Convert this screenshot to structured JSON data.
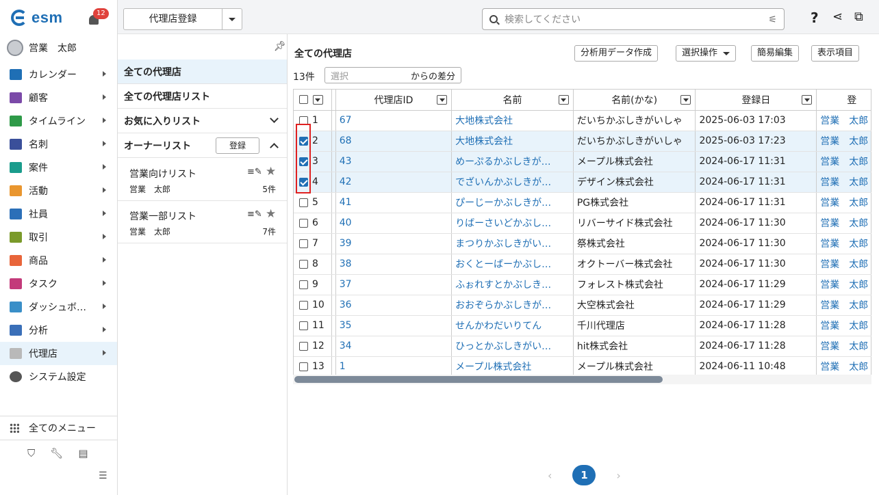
{
  "app": {
    "brand": "esm",
    "notification_count": "12"
  },
  "user": {
    "name": "営業　太郎"
  },
  "nav": {
    "items": [
      {
        "label": "カレンダー",
        "icon": "calendar-icon",
        "color": "#1f6fb5"
      },
      {
        "label": "顧客",
        "icon": "building-icon",
        "color": "#7b4aa8"
      },
      {
        "label": "タイムライン",
        "icon": "chat-icon",
        "color": "#2e9a48"
      },
      {
        "label": "名刺",
        "icon": "card-icon",
        "color": "#3a4f9a"
      },
      {
        "label": "案件",
        "icon": "folder-icon",
        "color": "#1a9c8c"
      },
      {
        "label": "活動",
        "icon": "clipboard-icon",
        "color": "#e9962f"
      },
      {
        "label": "社員",
        "icon": "person-icon",
        "color": "#2b6fb8"
      },
      {
        "label": "取引",
        "icon": "book-icon",
        "color": "#7a9a2a"
      },
      {
        "label": "商品",
        "icon": "box-icon",
        "color": "#e8653a"
      },
      {
        "label": "タスク",
        "icon": "task-icon",
        "color": "#c33a7a"
      },
      {
        "label": "ダッシュボ…",
        "icon": "dashboard-icon",
        "color": "#3a8fc8"
      },
      {
        "label": "分析",
        "icon": "chart-icon",
        "color": "#3a6fb8"
      },
      {
        "label": "代理店",
        "icon": "agency-icon",
        "color": "#b9b9b9"
      },
      {
        "label": "システム設定",
        "icon": "gear-icon",
        "color": "#555555"
      }
    ],
    "all_menu": "全てのメニュー"
  },
  "topbar": {
    "object_button": "代理店登録",
    "search_placeholder": "検索してください"
  },
  "lists": {
    "all": "全ての代理店",
    "all_list": "全ての代理店リスト",
    "favorites": "お気に入りリスト",
    "owner": "オーナーリスト",
    "register": "登録",
    "owner_items": [
      {
        "title": "営業向けリスト",
        "user": "営業　太郎",
        "count": "5件"
      },
      {
        "title": "営業一部リスト",
        "user": "営業　太郎",
        "count": "7件"
      }
    ]
  },
  "main": {
    "title": "全ての代理店",
    "buttons": {
      "analysis": "分析用データ作成",
      "select_ops": "選択操作",
      "quick_edit": "簡易編集",
      "display": "表示項目"
    },
    "count": "13件",
    "diff_placeholder": "選択",
    "diff_suffix": "からの差分",
    "columns": [
      "代理店ID",
      "名前",
      "名前(かな)",
      "登録日",
      "登"
    ],
    "rows": [
      {
        "n": "1",
        "checked": false,
        "id": "67",
        "name": "大地株式会社",
        "kana": "だいちかぶしきがいしゃ",
        "date": "2025-06-03 17:03",
        "user": "営業　太郎"
      },
      {
        "n": "2",
        "checked": true,
        "id": "68",
        "name": "大地株式会社",
        "kana": "だいちかぶしきがいしゃ",
        "date": "2025-06-03 17:23",
        "user": "営業　太郎"
      },
      {
        "n": "3",
        "checked": true,
        "id": "43",
        "name": "めーぷるかぶしきが…",
        "kana": "メープル株式会社",
        "date": "2024-06-17 11:31",
        "user": "営業　太郎"
      },
      {
        "n": "4",
        "checked": true,
        "id": "42",
        "name": "でざいんかぶしきが…",
        "kana": "デザイン株式会社",
        "date": "2024-06-17 11:31",
        "user": "営業　太郎"
      },
      {
        "n": "5",
        "checked": false,
        "id": "41",
        "name": "ぴーじーかぶしきが…",
        "kana": "PG株式会社",
        "date": "2024-06-17 11:31",
        "user": "営業　太郎"
      },
      {
        "n": "6",
        "checked": false,
        "id": "40",
        "name": "りばーさいどかぶし…",
        "kana": "リバーサイド株式会社",
        "date": "2024-06-17 11:30",
        "user": "営業　太郎"
      },
      {
        "n": "7",
        "checked": false,
        "id": "39",
        "name": "まつりかぶしきがい…",
        "kana": "祭株式会社",
        "date": "2024-06-17 11:30",
        "user": "営業　太郎"
      },
      {
        "n": "8",
        "checked": false,
        "id": "38",
        "name": "おくとーばーかぶし…",
        "kana": "オクトーバー株式会社",
        "date": "2024-06-17 11:30",
        "user": "営業　太郎"
      },
      {
        "n": "9",
        "checked": false,
        "id": "37",
        "name": "ふぉれすとかぶしき…",
        "kana": "フォレスト株式会社",
        "date": "2024-06-17 11:29",
        "user": "営業　太郎"
      },
      {
        "n": "10",
        "checked": false,
        "id": "36",
        "name": "おおぞらかぶしきが…",
        "kana": "大空株式会社",
        "date": "2024-06-17 11:29",
        "user": "営業　太郎"
      },
      {
        "n": "11",
        "checked": false,
        "id": "35",
        "name": "せんかわだいりてん",
        "kana": "千川代理店",
        "date": "2024-06-17 11:28",
        "user": "営業　太郎"
      },
      {
        "n": "12",
        "checked": false,
        "id": "34",
        "name": "ひっとかぶしきがい…",
        "kana": "hit株式会社",
        "date": "2024-06-17 11:28",
        "user": "営業　太郎"
      },
      {
        "n": "13",
        "checked": false,
        "id": "1",
        "name": "メープル株式会社",
        "kana": "メープル株式会社",
        "date": "2024-06-11 10:48",
        "user": "営業　太郎"
      }
    ],
    "page": "1",
    "colors": {
      "accent": "#1f6fb5",
      "highlight": "#e02020",
      "selected_row": "#e8f3fb"
    }
  }
}
